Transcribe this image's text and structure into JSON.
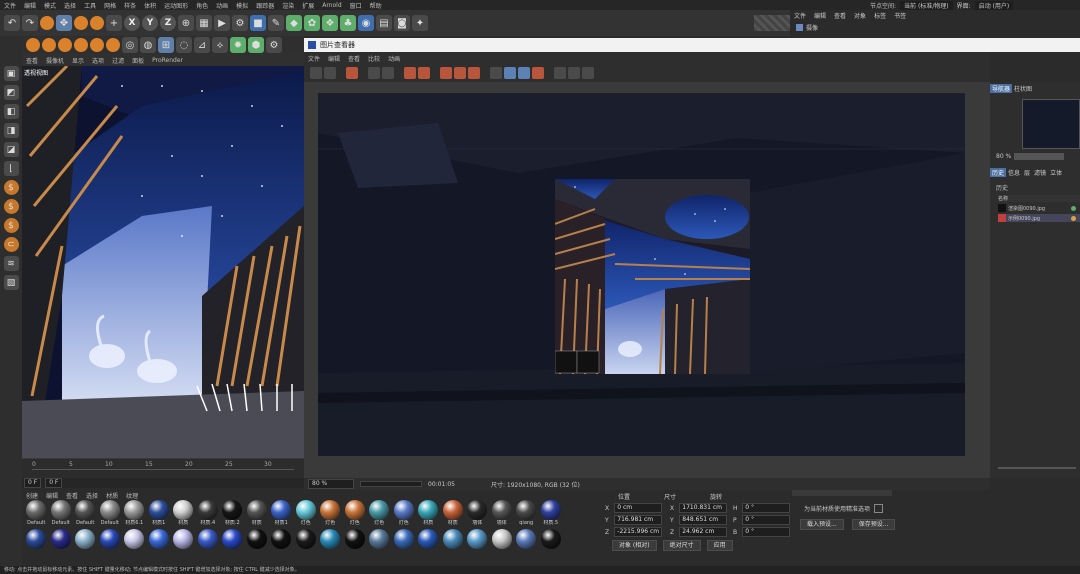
{
  "menubar": [
    "文件",
    "编辑",
    "模式",
    "选择",
    "工具",
    "网格",
    "样条",
    "体积",
    "运动图形",
    "角色",
    "动画",
    "模拟",
    "跟踪器",
    "渲染",
    "扩展",
    "Arnold",
    "窗口",
    "帮助"
  ],
  "menubar_right": {
    "node_space_label": "节点空间:",
    "node_space_value": "当前 (标准/物理)",
    "layout_label": "界面:",
    "layout_value": "启动 (用户)"
  },
  "toolbar": {
    "axis_x": "X",
    "axis_y": "Y",
    "axis_z": "Z"
  },
  "object_manager": {
    "menu": [
      "文件",
      "编辑",
      "查看",
      "对象",
      "标签",
      "书签"
    ],
    "item": "摄像"
  },
  "viewport": {
    "menu": [
      "查看",
      "摄像机",
      "显示",
      "选项",
      "过滤",
      "面板",
      "ProRender"
    ],
    "label": "透视视图"
  },
  "ruler": {
    "ticks": [
      "0",
      "5",
      "10",
      "15",
      "20",
      "25",
      "30"
    ]
  },
  "timeline": {
    "frame_start": "0 F",
    "frame_current": "0 F"
  },
  "picture_viewer": {
    "title": "图片查看器",
    "menu": [
      "文件",
      "编辑",
      "查看",
      "比较",
      "动画"
    ],
    "zoom": "80 %",
    "time": "00:01:05",
    "info": "尺寸: 1920x1080, RGB (32 位)"
  },
  "right_panel": {
    "tabs_top": [
      "导航器",
      "柱状图"
    ],
    "zoom": "80 %",
    "tabs": [
      "历史",
      "信息",
      "层",
      "滤镜",
      "立体"
    ],
    "section": "历史",
    "col_name": "名称",
    "files": [
      "渲染图0090.jpg",
      "示例0090.jpg"
    ]
  },
  "material_manager": {
    "menu": [
      "创建",
      "编辑",
      "查看",
      "选择",
      "材质",
      "纹理"
    ],
    "materials": [
      {
        "label": "Default",
        "color": "#6b6b6b"
      },
      {
        "label": "Default",
        "color": "#777777"
      },
      {
        "label": "Default",
        "color": "#555555"
      },
      {
        "label": "Default",
        "color": "#8a8a8a"
      },
      {
        "label": "材质6.1",
        "color": "#9a9a9a"
      },
      {
        "label": "材质1",
        "color": "#2d4f9c"
      },
      {
        "label": "材质",
        "color": "#cfcfcf"
      },
      {
        "label": "材质.4",
        "color": "#3a3a3a"
      },
      {
        "label": "材质.2",
        "color": "#161616"
      },
      {
        "label": "材质",
        "color": "#555555"
      },
      {
        "label": "材质1",
        "color": "#3b63c8"
      },
      {
        "label": "灯色",
        "color": "#66c8d8"
      },
      {
        "label": "灯色",
        "color": "#c8743a"
      },
      {
        "label": "灯色",
        "color": "#c8743a"
      },
      {
        "label": "灯色",
        "color": "#4a9aa8"
      },
      {
        "label": "灯色",
        "color": "#5a7ac8"
      },
      {
        "label": "材质",
        "color": "#3aa8b8"
      },
      {
        "label": "材质",
        "color": "#c8643a"
      },
      {
        "label": "墙体",
        "color": "#2a2a2a"
      },
      {
        "label": "墙体",
        "color": "#555555"
      },
      {
        "label": "qiang",
        "color": "#4a4a4a"
      },
      {
        "label": "材质.5",
        "color": "#3040a0"
      },
      {
        "label": "",
        "color": "#2a4a9a"
      },
      {
        "label": "",
        "color": "#2a2a8a"
      },
      {
        "label": "",
        "color": "#8ab0c8"
      },
      {
        "label": "",
        "color": "#2a4ab8"
      },
      {
        "label": "",
        "color": "#c8c8e8"
      },
      {
        "label": "",
        "color": "#3a6ad8"
      },
      {
        "label": "",
        "color": "#b8b8e8"
      },
      {
        "label": "",
        "color": "#3a5ac8"
      },
      {
        "label": "",
        "color": "#2a4ac8"
      },
      {
        "label": "",
        "color": "#111111"
      },
      {
        "label": "",
        "color": "#111111"
      },
      {
        "label": "",
        "color": "#1a1a1a"
      },
      {
        "label": "",
        "color": "#2a8ab8"
      },
      {
        "label": "",
        "color": "#111111"
      },
      {
        "label": "",
        "color": "#5a7a9a"
      },
      {
        "label": "",
        "color": "#3a6ab8"
      },
      {
        "label": "",
        "color": "#2a5ab8"
      },
      {
        "label": "",
        "color": "#4a8ab8"
      },
      {
        "label": "",
        "color": "#5a9ac8"
      },
      {
        "label": "",
        "color": "#c8c8c8"
      },
      {
        "label": "",
        "color": "#5a7ab8"
      },
      {
        "label": "",
        "color": "#1a1a1a"
      }
    ]
  },
  "coordinates": {
    "headers": [
      "位置",
      "尺寸",
      "旋转"
    ],
    "rows": [
      {
        "axis": "X",
        "pos": "0 cm",
        "size_axis": "X",
        "size": "1710.831 cm",
        "rot_axis": "H",
        "rot": "0 °"
      },
      {
        "axis": "Y",
        "pos": "716.981 cm",
        "size_axis": "Y",
        "size": "848.651 cm",
        "rot_axis": "P",
        "rot": "0 °"
      },
      {
        "axis": "Z",
        "pos": "-2215.996 cm",
        "size_axis": "Z",
        "size": "24.962 cm",
        "rot_axis": "B",
        "rot": "0 °"
      }
    ],
    "mode1": "对象 (相对)",
    "mode2": "绝对尺寸",
    "apply": "应用"
  },
  "attributes": {
    "checkbox_label": "为当前材质使用精准选项",
    "btn1": "载入预设...",
    "btn2": "保存预设..."
  },
  "statusbar": "移动: 点击并拖动鼠标移动元素。按住 SHIFT 键量化移动; 节点编辑模式时按住 SHIFT 键增加选择对象; 按住 CTRL 键减少选择对象。"
}
